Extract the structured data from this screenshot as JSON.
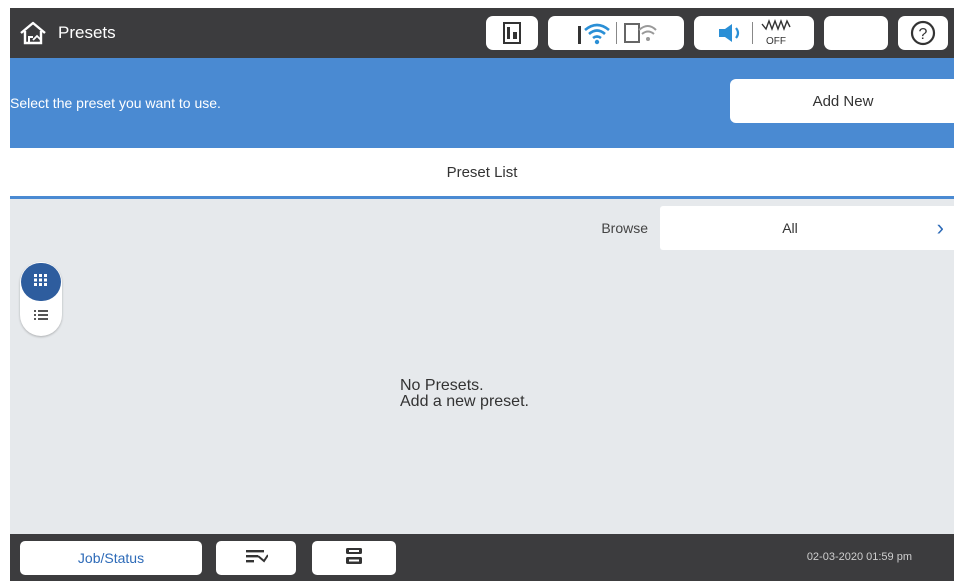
{
  "header": {
    "title": "Presets",
    "home_icon": "home-icon",
    "status_icons": [
      "ink-icon",
      "wifi-icon",
      "wifi-direct-icon",
      "sound-icon",
      "quiet-mode-off-icon",
      "sleep-icon",
      "help-icon"
    ],
    "quiet_mode_label": "OFF"
  },
  "instruction": {
    "text": "Select the preset you want to use.",
    "add_new_label": "Add New"
  },
  "list_header": {
    "title": "Preset List"
  },
  "browse": {
    "label": "Browse",
    "value": "All",
    "chevron": "›"
  },
  "view_toggle": {
    "selected": "grid",
    "options": [
      "grid-view-icon",
      "list-view-icon"
    ]
  },
  "empty_state": {
    "line1": "No Presets.",
    "line2": "Add a new preset."
  },
  "footer": {
    "job_status_label": "Job/Status",
    "datetime": "02-03-2020 01:59 pm"
  },
  "colors": {
    "top_bar": "#3c3c3e",
    "accent_blue": "#4a8ad2",
    "content_bg": "#e6e9ec",
    "link_blue": "#2e6bb8",
    "toggle_selected": "#2e5d9e"
  }
}
